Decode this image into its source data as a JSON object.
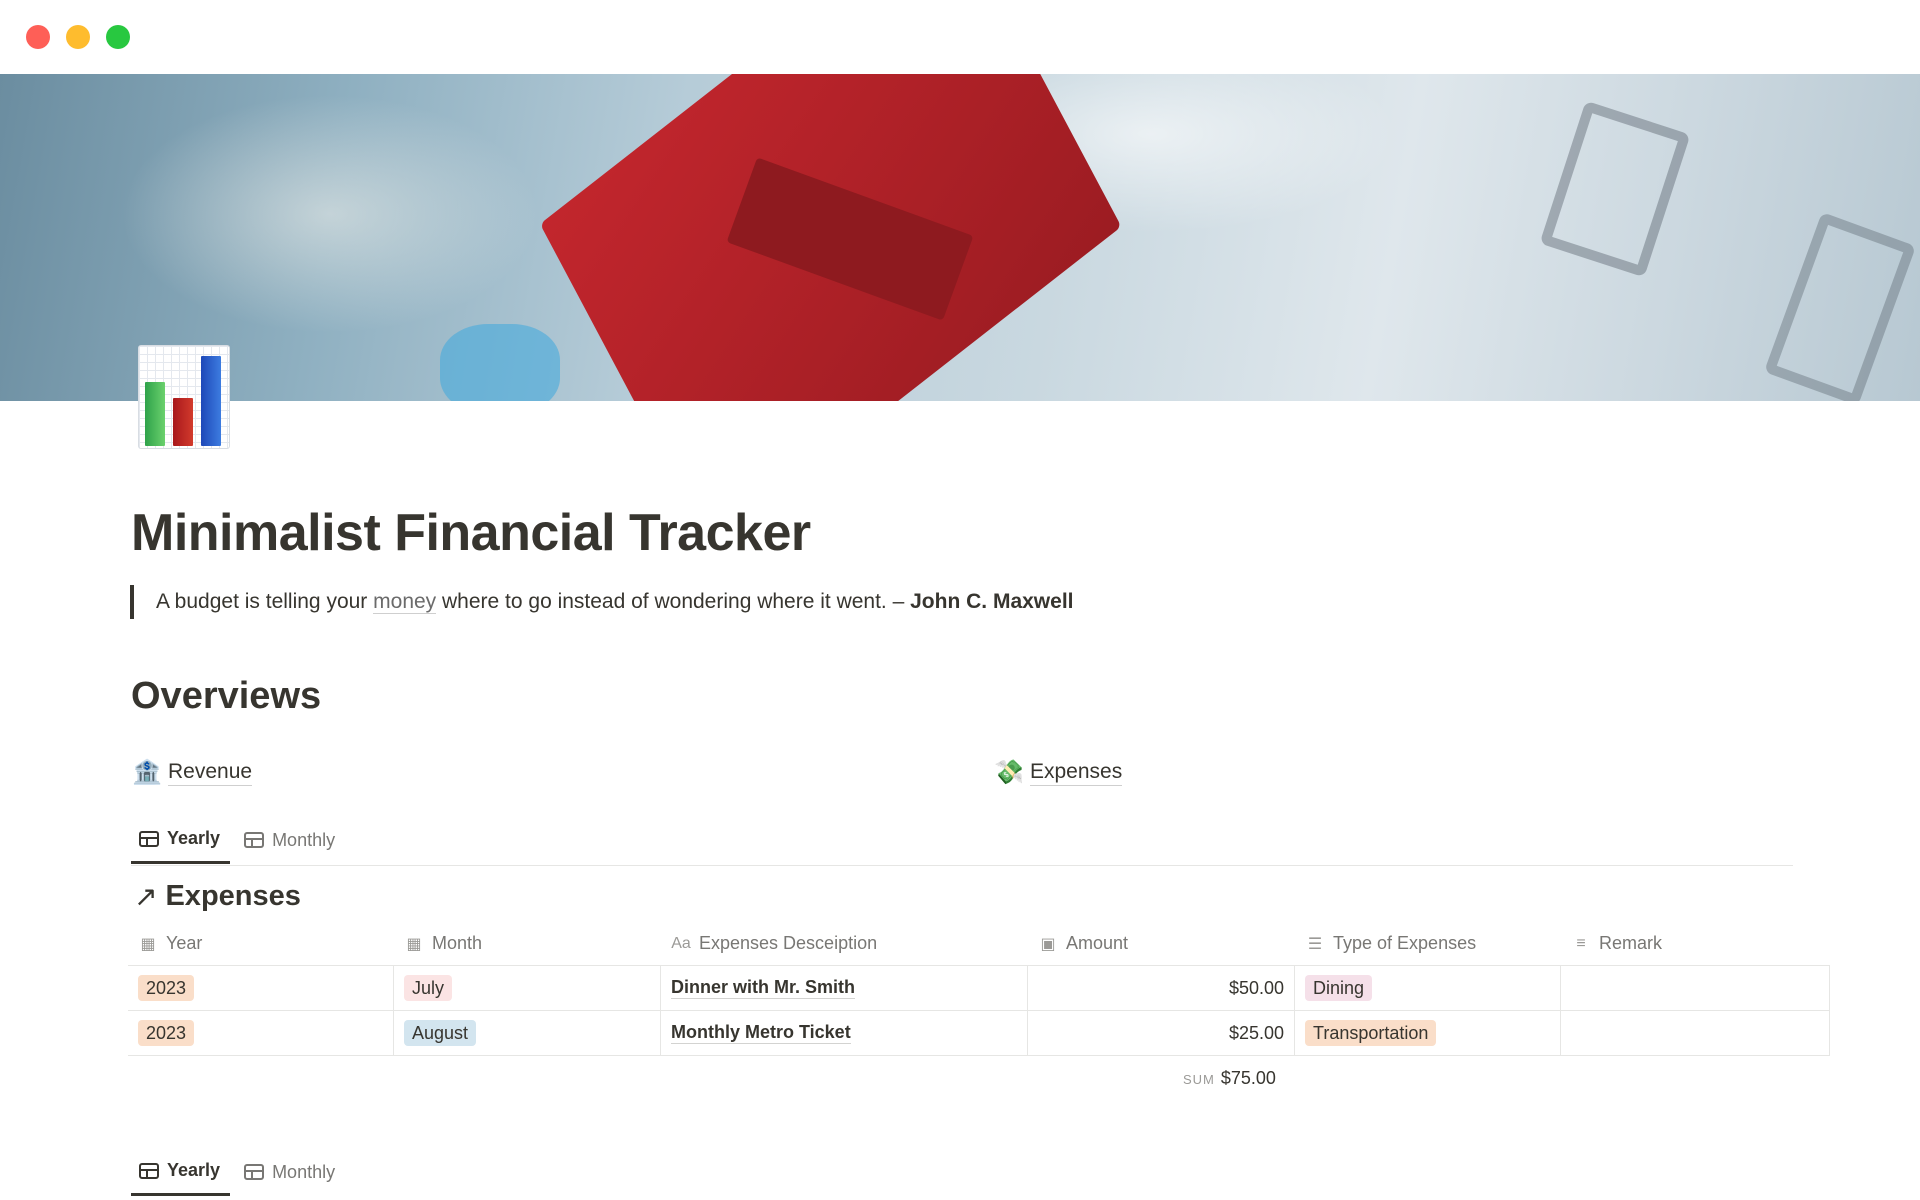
{
  "page": {
    "title": "Minimalist Financial Tracker",
    "icon": "bar-chart-icon",
    "quote": {
      "before": "A budget is telling your ",
      "link": "money",
      "after": " where to go instead of wondering where it went. – ",
      "author": "John C. Maxwell"
    },
    "section_heading": "Overviews"
  },
  "links": {
    "revenue": {
      "emoji": "🏦",
      "label": "Revenue"
    },
    "expenses": {
      "emoji": "💸",
      "label": "Expenses"
    }
  },
  "tabs": {
    "yearly": "Yearly",
    "monthly": "Monthly"
  },
  "database": {
    "title": "Expenses",
    "columns": [
      {
        "icon": "calendar-icon",
        "label": "Year"
      },
      {
        "icon": "calendar-icon",
        "label": "Month"
      },
      {
        "icon": "text-icon",
        "label": "Expenses Desceiption"
      },
      {
        "icon": "money-icon",
        "label": "Amount"
      },
      {
        "icon": "list-icon",
        "label": "Type of Expenses"
      },
      {
        "icon": "lines-icon",
        "label": "Remark"
      }
    ],
    "rows": [
      {
        "year": "2023",
        "month": "July",
        "description": "Dinner with Mr. Smith",
        "amount": "$50.00",
        "type": "Dining",
        "remark": ""
      },
      {
        "year": "2023",
        "month": "August",
        "description": "Monthly Metro Ticket",
        "amount": "$25.00",
        "type": "Transportation",
        "remark": ""
      }
    ],
    "sum_label": "SUM",
    "sum_value": "$75.00"
  },
  "colors": {
    "text": "#37352f",
    "muted": "#787774",
    "tag_orange": "#fadec9",
    "tag_pink": "#fbe4e4",
    "tag_blue": "#d3e5ef"
  }
}
